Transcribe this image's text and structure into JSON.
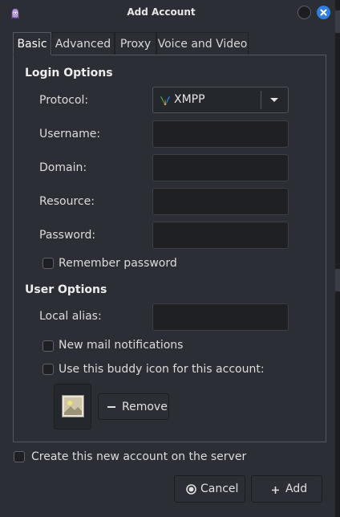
{
  "window": {
    "title": "Add Account"
  },
  "tabs": [
    {
      "label": "Basic"
    },
    {
      "label": "Advanced"
    },
    {
      "label": "Proxy"
    },
    {
      "label": "Voice and Video"
    }
  ],
  "login_options": {
    "title": "Login Options",
    "protocol_label": "Protocol:",
    "protocol_value": "XMPP",
    "username_label": "Username:",
    "username_value": "",
    "domain_label": "Domain:",
    "domain_value": "",
    "resource_label": "Resource:",
    "resource_value": "",
    "password_label": "Password:",
    "password_value": "",
    "remember_password_label": "Remember password",
    "remember_password_checked": false
  },
  "user_options": {
    "title": "User Options",
    "local_alias_label": "Local alias:",
    "local_alias_value": "",
    "new_mail_label": "New mail notifications",
    "new_mail_checked": false,
    "buddy_icon_label": "Use this buddy icon for this account:",
    "buddy_icon_checked": false,
    "remove_label": "Remove"
  },
  "footer": {
    "create_on_server_label": "Create this new account on the server",
    "create_on_server_checked": false,
    "cancel_label": "Cancel",
    "add_label": "Add"
  },
  "colors": {
    "accent": "#2f7fe0",
    "background": "#2b2e34",
    "field_background": "#1e2024"
  },
  "icons": {
    "app": "pidgin-icon",
    "protocol": "xmpp-icon",
    "close": "close-icon",
    "minimize": "minimize-icon",
    "remove": "minus-icon",
    "cancel": "cancel-icon",
    "add": "plus-icon",
    "dropdown": "chevron-down-icon"
  }
}
